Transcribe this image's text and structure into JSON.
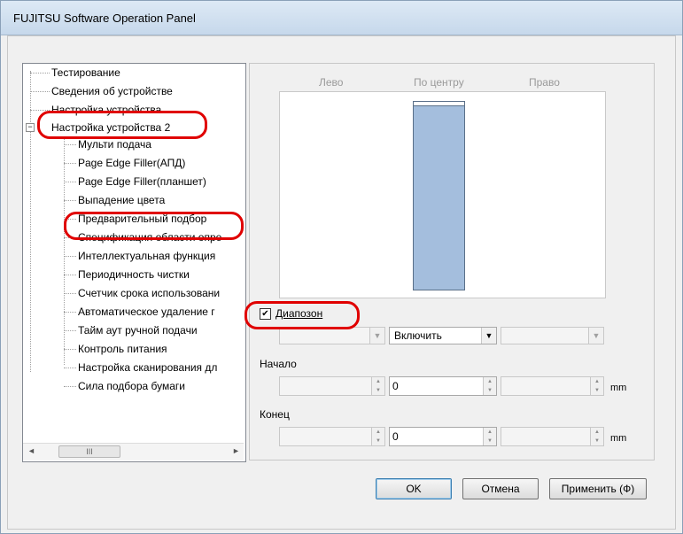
{
  "window": {
    "title": "FUJITSU Software Operation Panel"
  },
  "tree": {
    "items": [
      {
        "label": "Тестирование"
      },
      {
        "label": "Сведения об устройстве"
      },
      {
        "label": "Настройка устройства"
      },
      {
        "label": "Настройка устройства 2"
      },
      {
        "label": "Мульти подача"
      },
      {
        "label": "Page Edge Filler(АПД)"
      },
      {
        "label": "Page Edge Filler(планшет)"
      },
      {
        "label": "Выпадение цвета"
      },
      {
        "label": "Предварительный подбор"
      },
      {
        "label": "Спецификация области опре"
      },
      {
        "label": "Интеллектуальная функция"
      },
      {
        "label": "Периодичность чистки"
      },
      {
        "label": "Счетчик срока использовани"
      },
      {
        "label": "Автоматическое удаление г"
      },
      {
        "label": "Тайм аут ручной подачи"
      },
      {
        "label": "Контроль питания"
      },
      {
        "label": "Настройка сканирования дл"
      },
      {
        "label": "Сила подбора бумаги"
      }
    ],
    "expander_symbol": "−",
    "scroll_left": "◄",
    "scroll_right": "►",
    "scroll_thumb": "III"
  },
  "preview": {
    "col_left": "Лево",
    "col_center": "По центру",
    "col_right": "Право"
  },
  "range": {
    "checkbox_label": "Диапозон",
    "checked_mark": "✔",
    "combo_left_value": "",
    "combo_center_value": "Включить",
    "combo_right_value": ""
  },
  "start": {
    "label": "Начало",
    "left_value": "",
    "center_value": "0",
    "right_value": "",
    "unit": "mm"
  },
  "end": {
    "label": "Конец",
    "left_value": "",
    "center_value": "0",
    "right_value": "",
    "unit": "mm"
  },
  "buttons": {
    "ok": "OK",
    "cancel": "Отмена",
    "apply": "Применить (Ф)"
  },
  "icons": {
    "dropdown": "▼",
    "spin_up": "▲",
    "spin_down": "▼"
  },
  "colors": {
    "highlight": "#e00000",
    "paper": "#a4bedd"
  }
}
